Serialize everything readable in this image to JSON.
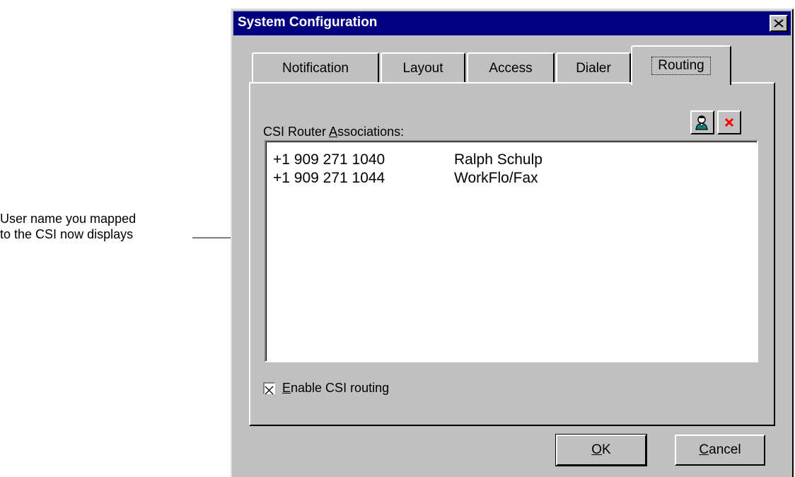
{
  "annotation": {
    "callout_line1": "User name you mapped",
    "callout_line2": "to the CSI now displays"
  },
  "dialog": {
    "title": "System Configuration",
    "close_glyph": "✕"
  },
  "tabs": [
    {
      "label": "Notification",
      "active": false
    },
    {
      "label": "Layout",
      "active": false
    },
    {
      "label": "Access",
      "active": false
    },
    {
      "label": "Dialer",
      "active": false
    },
    {
      "label": "Routing",
      "active": true
    }
  ],
  "routing": {
    "label_prefix": "CSI Router ",
    "label_access_key": "A",
    "label_suffix": "ssociations:",
    "associations": [
      {
        "csi": "+1 909 271 1040",
        "user": "Ralph Schulp"
      },
      {
        "csi": "+1 909 271 1044",
        "user": "WorkFlo/Fax"
      }
    ],
    "enable_access_key": "E",
    "enable_label_rest": "nable CSI routing",
    "enable_checked": true,
    "icons": {
      "add_association": "user-add-icon",
      "delete_association": "delete-x-icon"
    },
    "delete_color": "#ff0000"
  },
  "buttons": {
    "ok_access_key": "O",
    "ok_rest": "K",
    "cancel_access_key": "C",
    "cancel_rest": "ancel"
  }
}
